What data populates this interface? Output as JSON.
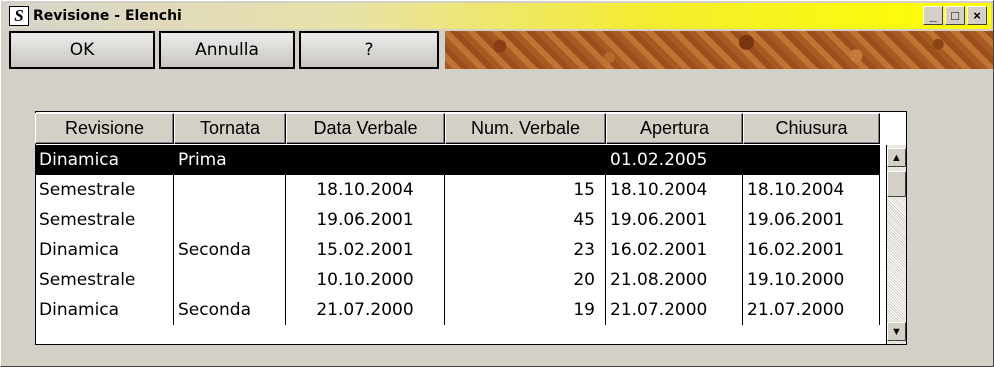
{
  "window": {
    "title": "Revisione - Elenchi",
    "app_icon": "S",
    "controls": {
      "minimize": "_",
      "maximize": "□",
      "close": "×"
    }
  },
  "toolbar": {
    "ok_label": "OK",
    "cancel_label": "Annulla",
    "help_label": "?"
  },
  "table": {
    "columns": [
      "Revisione",
      "Tornata",
      "Data Verbale",
      "Num. Verbale",
      "Apertura",
      "Chiusura"
    ],
    "rows": [
      [
        "Dinamica",
        "Prima",
        "",
        "",
        "01.02.2005",
        ""
      ],
      [
        "Semestrale",
        "",
        "18.10.2004",
        "15",
        "18.10.2004",
        "18.10.2004"
      ],
      [
        "Semestrale",
        "",
        "19.06.2001",
        "45",
        "19.06.2001",
        "19.06.2001"
      ],
      [
        "Dinamica",
        "Seconda",
        "15.02.2001",
        "23",
        "16.02.2001",
        "16.02.2001"
      ],
      [
        "Semestrale",
        "",
        "10.10.2000",
        "20",
        "21.08.2000",
        "19.10.2000"
      ],
      [
        "Dinamica",
        "Seconda",
        "21.07.2000",
        "19",
        "21.07.2000",
        "21.07.2000"
      ]
    ],
    "selected_row": 0
  },
  "icons": {
    "scroll_up": "scroll-up-arrow-icon",
    "scroll_down": "scroll-down-arrow-icon"
  },
  "colors": {
    "title_gradient_end": "#ffff00",
    "selection": "#000000",
    "window_bg": "#d4d0c8"
  }
}
